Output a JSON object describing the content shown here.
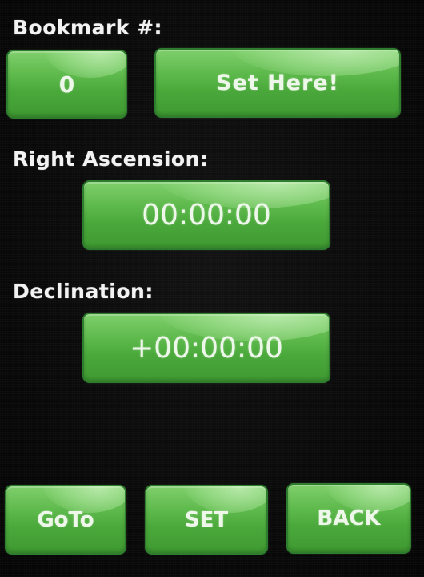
{
  "bookmark": {
    "label": "Bookmark #:",
    "number": "0",
    "set_here_label": "Set Here!"
  },
  "right_ascension": {
    "label": "Right Ascension:",
    "value": "00:00:00"
  },
  "declination": {
    "label": "Declination:",
    "value": "+00:00:00"
  },
  "bottom_bar": {
    "goto_label": "GoTo",
    "set_label": "SET",
    "back_label": "BACK"
  },
  "colors": {
    "background": "#070707",
    "button_green": "#4aa83b",
    "button_border": "#2e7d2e",
    "text": "#f2f2f2"
  }
}
